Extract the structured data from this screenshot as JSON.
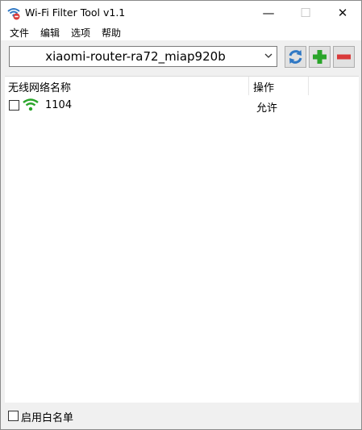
{
  "window": {
    "title": "Wi-Fi Filter Tool v1.1",
    "minimize": "—",
    "maximize": "☐",
    "close": "✕"
  },
  "menu": [
    "文件",
    "编辑",
    "选项",
    "帮助"
  ],
  "toolbar": {
    "interface_selected": "xiaomi-router-ra72_miap920b",
    "refresh_icon": "refresh-icon",
    "add_icon": "plus-icon",
    "remove_icon": "minus-icon"
  },
  "list": {
    "columns": [
      "无线网络名称",
      "操作"
    ],
    "rows": [
      {
        "checked": false,
        "icon": "wifi-icon",
        "name": "1104",
        "action": "允许"
      }
    ]
  },
  "footer": {
    "whitelist_label": "启用白名单",
    "whitelist_checked": false
  },
  "colors": {
    "wifi_green": "#2aa52a",
    "refresh_blue": "#2f78c4",
    "add_green": "#2aa52a",
    "remove_red": "#d93a3a"
  }
}
